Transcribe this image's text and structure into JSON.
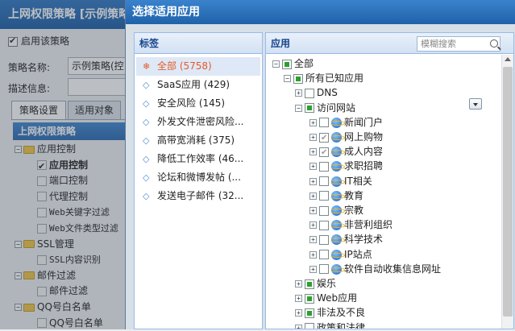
{
  "background": {
    "window_title": "上网权限策略 [示例策略",
    "enable_label": "启用该策略",
    "name_label": "策略名称:",
    "name_value": "示例策略(控",
    "desc_label": "描述信息:",
    "tabs": [
      "策略设置",
      "适用对象"
    ],
    "tree_header": "上网权限策略",
    "tree": [
      {
        "label": "应用控制",
        "type": "folder",
        "expanded": true
      },
      {
        "label": "应用控制",
        "type": "leaf",
        "checked": true,
        "selected": true
      },
      {
        "label": "端口控制",
        "type": "leaf"
      },
      {
        "label": "代理控制",
        "type": "leaf"
      },
      {
        "label": "Web关键字过滤",
        "type": "leaf",
        "mono": true
      },
      {
        "label": "Web文件类型过滤",
        "type": "leaf",
        "mono": true
      },
      {
        "label": "SSL管理",
        "type": "folder",
        "expanded": true
      },
      {
        "label": "SSL内容识别",
        "type": "leaf",
        "mono": true
      },
      {
        "label": "邮件过滤",
        "type": "folder",
        "expanded": true
      },
      {
        "label": "邮件过滤",
        "type": "leaf"
      },
      {
        "label": "QQ号白名单",
        "type": "folder",
        "expanded": true
      },
      {
        "label": "QQ号白名单",
        "type": "leaf"
      }
    ]
  },
  "dialog": {
    "title": "选择适用应用",
    "tags_header": "标签",
    "apps_header": "应用",
    "search_placeholder": "模糊搜索",
    "tags": [
      {
        "label": "全部 (5758)",
        "active": true,
        "icon": "snowflake-icon"
      },
      {
        "label": "SaaS应用 (429)",
        "icon": "tag-icon"
      },
      {
        "label": "安全风险 (145)",
        "icon": "tag-icon"
      },
      {
        "label": "外发文件泄密风险...",
        "icon": "tag-icon"
      },
      {
        "label": "高带宽消耗 (375)",
        "icon": "tag-icon"
      },
      {
        "label": "降低工作效率 (46...",
        "icon": "tag-icon"
      },
      {
        "label": "论坛和微博发帖 (...",
        "icon": "tag-icon"
      },
      {
        "label": "发送电子邮件 (32...",
        "icon": "tag-icon"
      }
    ],
    "app_tree": [
      {
        "label": "全部",
        "level": 0,
        "toggle": "-",
        "state": "part"
      },
      {
        "label": "所有已知应用",
        "level": 1,
        "toggle": "-",
        "state": "part"
      },
      {
        "label": "DNS",
        "level": 2,
        "toggle": "+",
        "state": "none"
      },
      {
        "label": "访问网站",
        "level": 2,
        "toggle": "-",
        "state": "part",
        "dropdown": true
      },
      {
        "label": "新闻门户",
        "level": 3,
        "toggle": "+",
        "state": "none",
        "globe": true
      },
      {
        "label": "网上购物",
        "level": 3,
        "toggle": "+",
        "state": "on",
        "globe": true
      },
      {
        "label": "成人内容",
        "level": 3,
        "toggle": "+",
        "state": "on",
        "globe": true
      },
      {
        "label": "求职招聘",
        "level": 3,
        "toggle": "+",
        "state": "none",
        "globe": true
      },
      {
        "label": "IT相关",
        "level": 3,
        "toggle": "+",
        "state": "none",
        "globe": true
      },
      {
        "label": "教育",
        "level": 3,
        "toggle": "+",
        "state": "none",
        "globe": true
      },
      {
        "label": "宗教",
        "level": 3,
        "toggle": "+",
        "state": "none",
        "globe": true
      },
      {
        "label": "非营利组织",
        "level": 3,
        "toggle": "+",
        "state": "none",
        "globe": true
      },
      {
        "label": "科学技术",
        "level": 3,
        "toggle": "+",
        "state": "none",
        "globe": true
      },
      {
        "label": "IP站点",
        "level": 3,
        "toggle": "+",
        "state": "none",
        "globe": true
      },
      {
        "label": "软件自动收集信息网址",
        "level": 3,
        "toggle": "+",
        "state": "none",
        "globe": true
      },
      {
        "label": "娱乐",
        "level": 2,
        "toggle": "+",
        "state": "part"
      },
      {
        "label": "Web应用",
        "level": 2,
        "toggle": "+",
        "state": "part"
      },
      {
        "label": "非法及不良",
        "level": 2,
        "toggle": "+",
        "state": "part"
      },
      {
        "label": "政策和法律",
        "level": 2,
        "toggle": "+",
        "state": "none"
      }
    ]
  }
}
